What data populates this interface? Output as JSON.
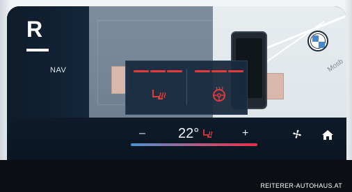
{
  "branding": {
    "logo_letter": "R",
    "footer_text": "REITERER-AUTOHAUS.AT",
    "brand_badge_icon": "bmw-roundel-icon"
  },
  "sidebar": {
    "nav_label": "NAV"
  },
  "map": {
    "label_fragment": "Mosb"
  },
  "popup": {
    "seat_heat_icon": "seat-heating-icon",
    "steering_heat_icon": "steering-wheel-heating-icon",
    "heat_color": "#e33a3a",
    "seat_heat_level": 3,
    "steering_heat_level": 3
  },
  "climate": {
    "minus_label": "–",
    "temperature": "22°",
    "plus_label": "+",
    "seat_icon": "seat-heating-small-icon"
  },
  "controls": {
    "fan_icon": "fan-icon",
    "home_icon": "home-icon"
  }
}
